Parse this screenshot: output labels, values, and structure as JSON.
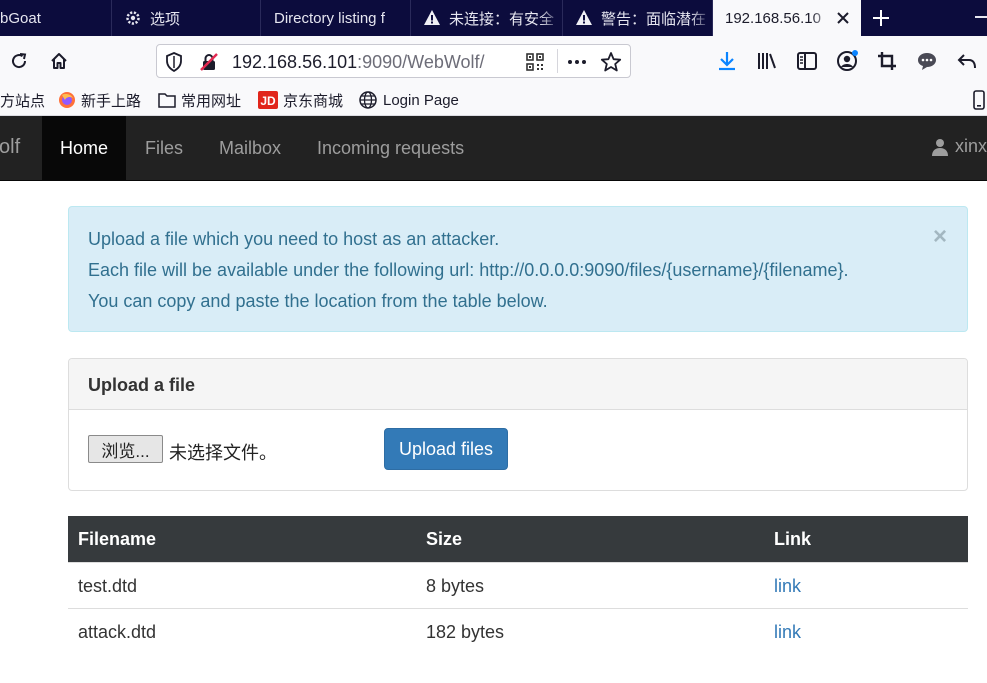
{
  "browser": {
    "tabs": [
      {
        "label": "bGoat"
      },
      {
        "label": "选项"
      },
      {
        "label": "Directory listing f"
      },
      {
        "label": "未连接：有安全"
      },
      {
        "label": "警告：面临潜在"
      },
      {
        "label": "192.168.56.10"
      }
    ],
    "address": {
      "host": "192.168.56.101",
      "rest": ":9090/WebWolf/"
    },
    "bookmarks": [
      {
        "label": "方站点"
      },
      {
        "label": "新手上路"
      },
      {
        "label": "常用网址"
      },
      {
        "label": "京东商城"
      },
      {
        "label": "Login Page"
      }
    ]
  },
  "site_nav": {
    "brand": "olf",
    "items": [
      {
        "label": "Home"
      },
      {
        "label": "Files"
      },
      {
        "label": "Mailbox"
      },
      {
        "label": "Incoming requests"
      }
    ],
    "user": "xinx"
  },
  "alert": {
    "lines": [
      "Upload a file which you need to host as an attacker.",
      "Each file will be available under the following url: http://0.0.0.0:9090/files/{username}/{filename}.",
      "You can copy and paste the location from the table below."
    ],
    "close": "×"
  },
  "upload_panel": {
    "title": "Upload a file",
    "browse_label": "浏览...",
    "no_file_text": "未选择文件。",
    "submit_label": "Upload files"
  },
  "files_table": {
    "headers": [
      "Filename",
      "Size",
      "Link"
    ],
    "rows": [
      {
        "filename": "test.dtd",
        "size": "8 bytes",
        "link": "link"
      },
      {
        "filename": "attack.dtd",
        "size": "182 bytes",
        "link": "link"
      }
    ]
  },
  "colors": {
    "navbar_bg": "#222222",
    "alert_bg": "#d9edf7",
    "alert_text": "#31708f",
    "primary": "#337ab7",
    "table_header": "#363a3d"
  }
}
